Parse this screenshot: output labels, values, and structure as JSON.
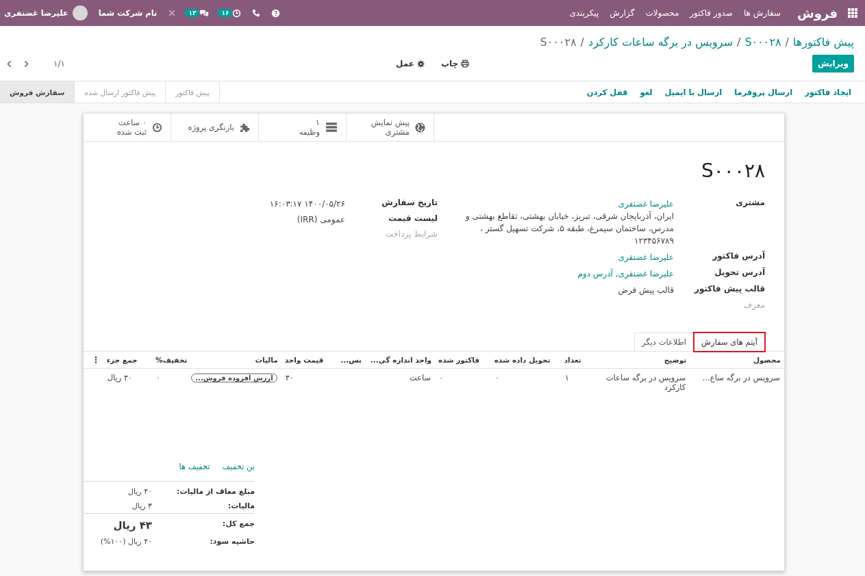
{
  "navbar": {
    "app_title": "فروش",
    "menu": [
      "سفارش ها",
      "صدور فاکتور",
      "محصولات",
      "گزارش",
      "پیکربندی"
    ],
    "activities_count": "۱۶",
    "messages_count": "۱۳",
    "company": "نام شرکت شما",
    "user_name": "علیرضا غضنفری"
  },
  "breadcrumb": {
    "separator": "/",
    "items": [
      {
        "label": "پیش فاکتورها",
        "current": false
      },
      {
        "label": "S۰۰۰۲۸",
        "current": false
      },
      {
        "label": "سرویس در برگه ساعات کارکرد",
        "current": false
      },
      {
        "label": "S۰۰۰۲۸",
        "current": true
      }
    ]
  },
  "toolbar": {
    "edit_button": "ویرایش",
    "print": "چاپ",
    "action": "عمل",
    "pager": "۱/۱"
  },
  "header_buttons": [
    "ایجاد فاکتور",
    "ارسال پروفرما",
    "ارسال با ایمیل",
    "لغو",
    "قفل کردن"
  ],
  "statusbar": [
    {
      "label": "پیش فاکتور",
      "selected": false
    },
    {
      "label": "پیش فاکتور ارسال شده",
      "selected": false
    },
    {
      "label": "سفارش فروش",
      "selected": true
    }
  ],
  "smart_buttons": [
    {
      "kind": "globe",
      "lines": [
        "پیش نمایش",
        "مشتری"
      ]
    },
    {
      "kind": "tasks",
      "lines": [
        "۱",
        "وظیفه"
      ]
    },
    {
      "kind": "puzzle",
      "lines": [
        "بازنگری پروژه"
      ]
    },
    {
      "kind": "clock",
      "lines": [
        "۰ ساعت",
        "ثبت شده"
      ]
    }
  ],
  "title": "S۰۰۰۲۸",
  "group_1": [
    {
      "label": "مشتری",
      "value": "علیرضا غضنفری",
      "link": true,
      "address_lines": [
        "ایران، آذربایجان شرقی، تبریز، خیابان بهشتی، تقاطع بهشتی و",
        "مدرس، ساختمان سیمرغ، طبقه ۵، شرکت تسهیل گستر ،",
        "۱۲۳۴۵۶۷۸۹"
      ]
    },
    {
      "label": "آدرس فاکتور",
      "value": "علیرضا غضنفری",
      "link": true
    },
    {
      "label": "آدرس تحویل",
      "value": "علیرضا غضنفری, آدرس دوم",
      "link": true
    },
    {
      "label": "قالب پیش فاکتور",
      "value": "قالب پیش فرض",
      "link": false
    },
    {
      "label": "معرف"
    }
  ],
  "group_2": [
    {
      "label": "تاریخ سفارش",
      "value": "۱۴۰۰/۰۵/۲۶ ۱۶:۰۳:۱۷",
      "link": false
    },
    {
      "label": "لیست قیمت",
      "value": "عمومی (IRR)",
      "link": false
    },
    {
      "label": "شرایط پرداخت"
    }
  ],
  "tabs": [
    {
      "label": "آیتم های سفارش",
      "selected": true,
      "highlighted": true
    },
    {
      "label": "اطلاعات دیگر",
      "selected": false,
      "highlighted": false
    }
  ],
  "table": {
    "columns": [
      "محصول",
      "توضیح",
      "تعداد",
      "تحویل داده شده",
      "فاکتور شده",
      "واحد اندازه گی...",
      "بس...",
      "قیمت واحد",
      "مالیات",
      "تخفیف%",
      "جمع جزء"
    ],
    "rows": [
      {
        "cells": [
          {
            "kind": "text",
            "text": "سرویس در برگه ساع..."
          },
          {
            "kind": "text",
            "text": "سرویس در برگه ساعات کارکرد"
          },
          {
            "kind": "number",
            "text": "۱"
          },
          {
            "kind": "number",
            "text": "۰"
          },
          {
            "kind": "number",
            "text": "۰"
          },
          {
            "kind": "text",
            "text": "ساعت"
          },
          {
            "kind": "text"
          },
          {
            "kind": "number",
            "text": "۴۰"
          },
          {
            "kind": "tag",
            "text": "ارزش افزوده فروش..."
          },
          {
            "kind": "number",
            "text": "۰"
          },
          {
            "kind": "number",
            "text": "۴۰ ریال"
          }
        ]
      }
    ]
  },
  "discount_links": [
    "بن تخفیف",
    "تخفیف ها"
  ],
  "totals": [
    {
      "label": "مبلغ معاف از مالیات:",
      "value": "۴۰ ریال",
      "kind": "plain"
    },
    {
      "label": "مالیات:",
      "value": "۳ ریال",
      "kind": "plain"
    },
    {
      "label": "جمع کل:",
      "value": "۴۳ ریال",
      "kind": "grand"
    },
    {
      "label": "حاشیه سود:",
      "value": "۴۰ ریال (۱۰۰%)",
      "kind": "plain"
    }
  ]
}
